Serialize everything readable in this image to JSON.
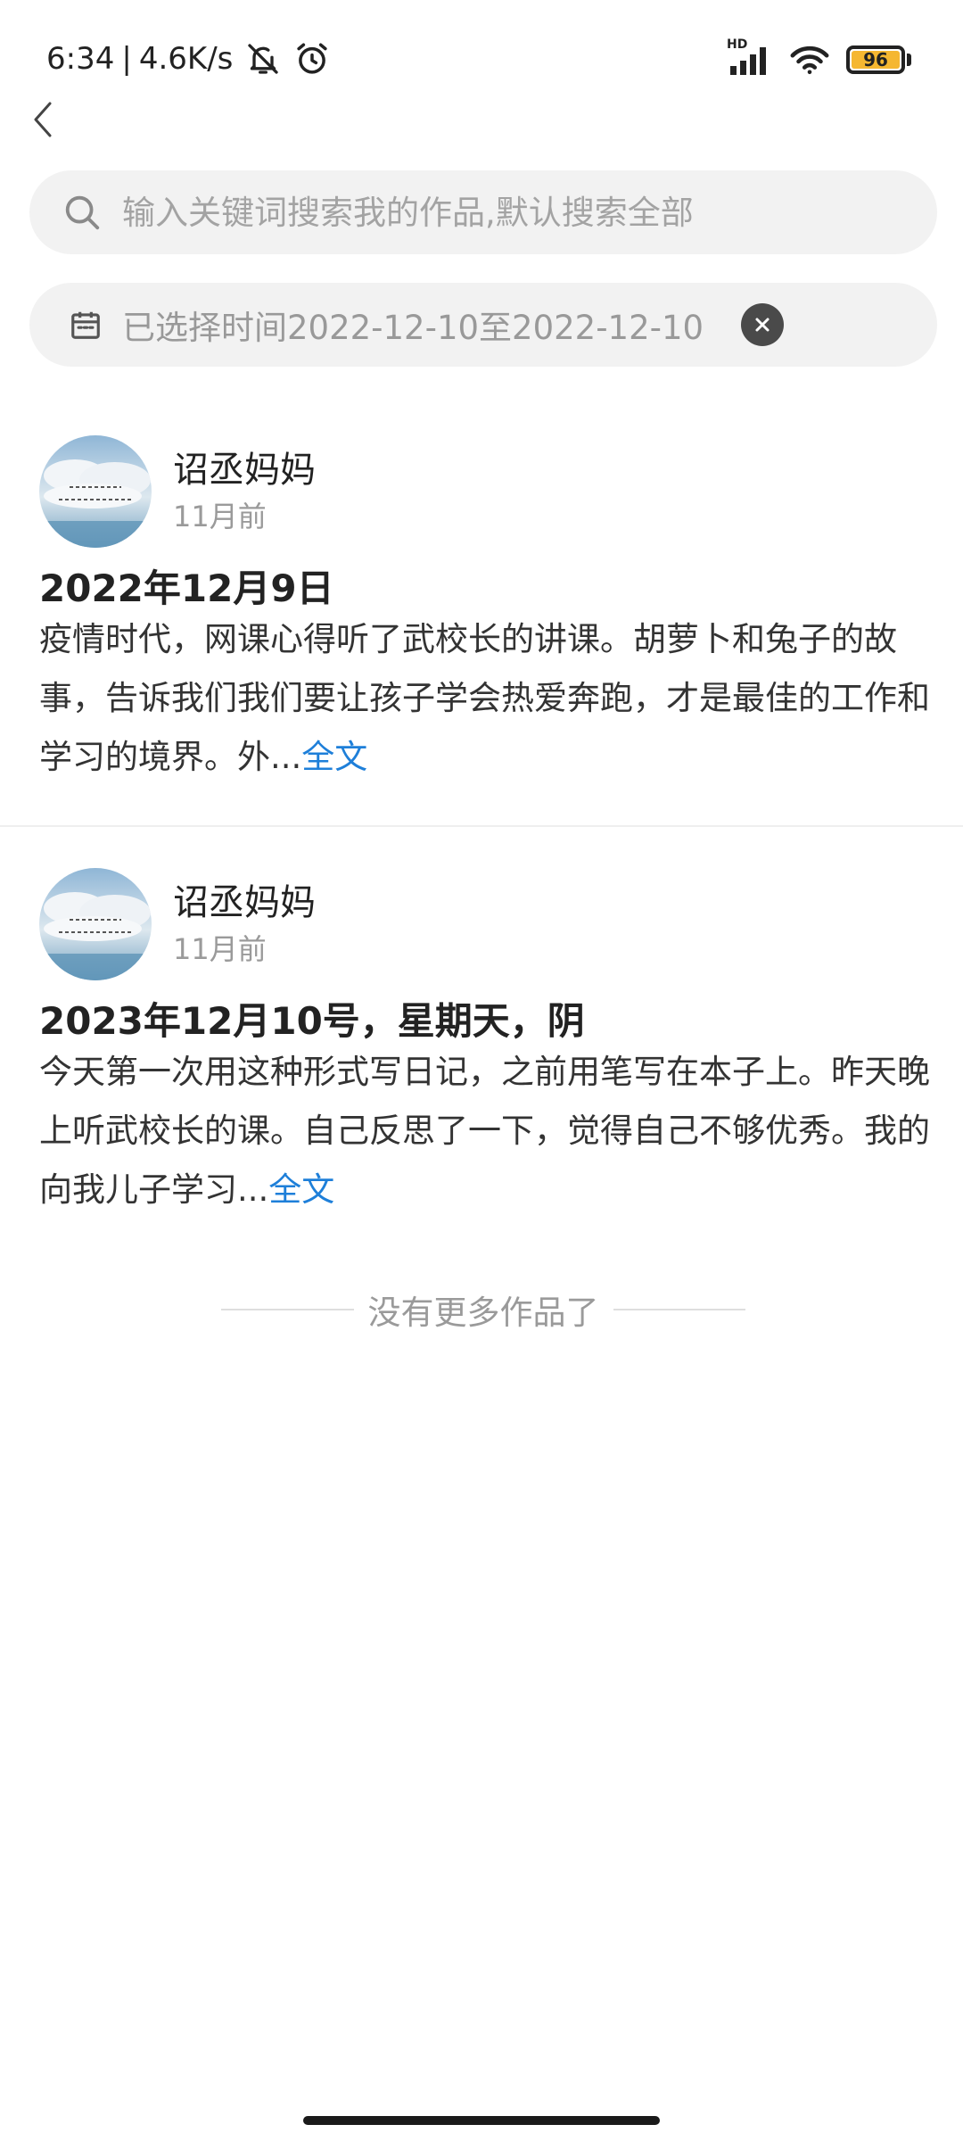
{
  "status_bar": {
    "time": "6:34",
    "separator": "|",
    "network_speed": "4.6K/s",
    "network_type": "HD",
    "battery": "96",
    "icons": [
      "bell-off-icon",
      "alarm-icon",
      "signal-icon",
      "wifi-icon",
      "battery-icon"
    ]
  },
  "search": {
    "placeholder": "输入关键词搜索我的作品,默认搜索全部",
    "value": ""
  },
  "filter": {
    "label": "已选择时间2022-12-10至2022-12-10"
  },
  "posts": [
    {
      "author": "诏丞妈妈",
      "time": "11月前",
      "title": "2022年12月9日",
      "excerpt": "疫情时代，网课心得听了武校长的讲课。胡萝卜和兔子的故事，告诉我们我们要让孩子学会热爱奔跑，才是最佳的工作和学习的境界。外...",
      "read_more": "全文"
    },
    {
      "author": "诏丞妈妈",
      "time": "11月前",
      "title": "2023年12月10号，星期天，阴",
      "excerpt": "今天第一次用这种形式写日记，之前用笔写在本子上。昨天晚上听武校长的课。自己反思了一下，觉得自己不够优秀。我的向我儿子学习...",
      "read_more": "全文"
    }
  ],
  "end_message": "没有更多作品了",
  "colors": {
    "accent": "#1e7fd9",
    "pill_bg": "#f2f2f2",
    "battery": "#f5b731"
  }
}
